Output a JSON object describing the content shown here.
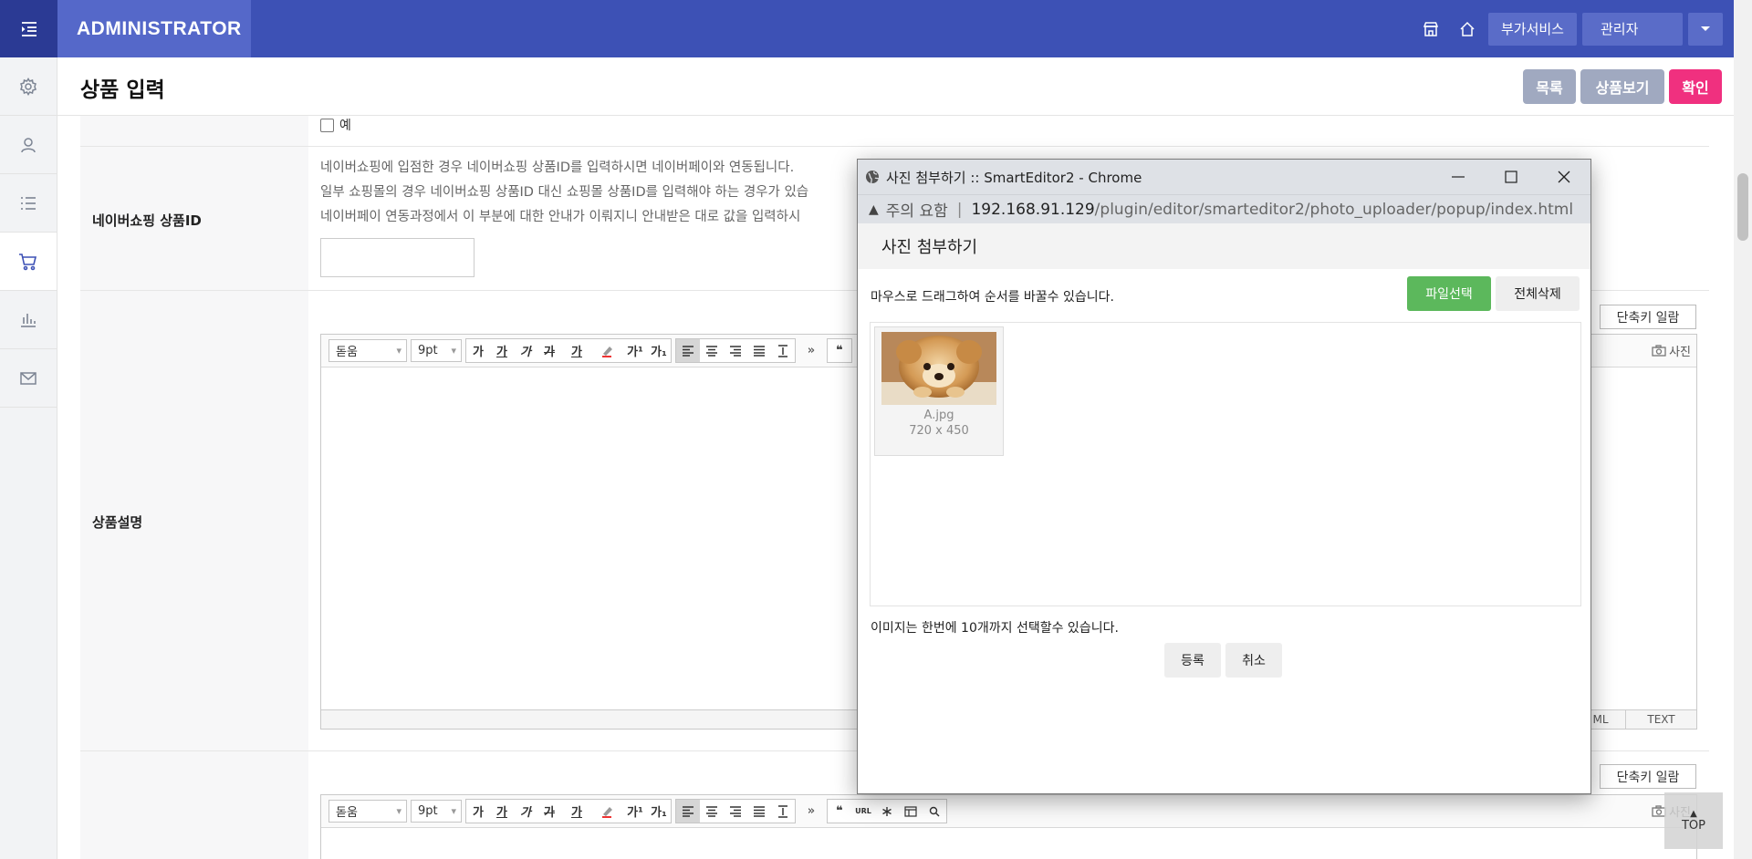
{
  "topbar": {
    "brand": "ADMINISTRATOR",
    "addon_label": "부가서비스",
    "admin_label": "관리자"
  },
  "page": {
    "title": "상품 입력",
    "btn_list": "목록",
    "btn_view": "상품보기",
    "btn_confirm": "확인"
  },
  "form": {
    "checkbox_label": "예",
    "naver_label": "네이버쇼핑 상품ID",
    "naver_help_1": "네이버쇼핑에 입점한 경우 네이버쇼핑 상품ID를 입력하시면 네이버페이와 연동됩니다.",
    "naver_help_2": "일부 쇼핑몰의 경우 네이버쇼핑 상품ID 대신 쇼핑몰 상품ID를 입력해야 하는 경우가 있습",
    "naver_help_3": "네이버페이 연동과정에서 이 부분에 대한 안내가 이뤄지니 안내받은 대로 값을 입력하시",
    "desc_label": "상품설명",
    "shortcut_label": "단축키 일람",
    "photo_label": "사진",
    "font_select": "돋움",
    "size_select": "9pt",
    "mode_tabs": [
      "HTML",
      "TEXT"
    ],
    "mode_tab_html_visible": "ML"
  },
  "toolbar": {
    "format_buttons": [
      "가",
      "가",
      "가",
      "가",
      "가"
    ],
    "sup_label": "가¹",
    "sub_label": "가₁",
    "more_label": "»",
    "quote_label": "❝",
    "url_label": "URL"
  },
  "popup": {
    "window_title": "사진 첨부하기 :: SmartEditor2 - Chrome",
    "security_label": "주의 요함",
    "url_host": "192.168.91.129",
    "url_path": "/plugin/editor/smarteditor2/photo_uploader/popup/index.html",
    "heading": "사진 첨부하기",
    "drag_info": "마우스로 드래그하여 순서를 바꿀수 있습니다.",
    "btn_select_file": "파일선택",
    "btn_delete_all": "전체삭제",
    "file_name": "A.jpg",
    "file_dims": "720 x 450",
    "limit_info": "이미지는 한번에 10개까지 선택할수 있습니다.",
    "btn_register": "등록",
    "btn_cancel": "취소"
  },
  "fab": {
    "top_label": "TOP"
  },
  "colors": {
    "topbar": "#3d51b5",
    "brand_bg": "#5568c9",
    "confirm": "#f0307f",
    "gray_button": "#a0a9c0",
    "green_button": "#5cb85c"
  }
}
